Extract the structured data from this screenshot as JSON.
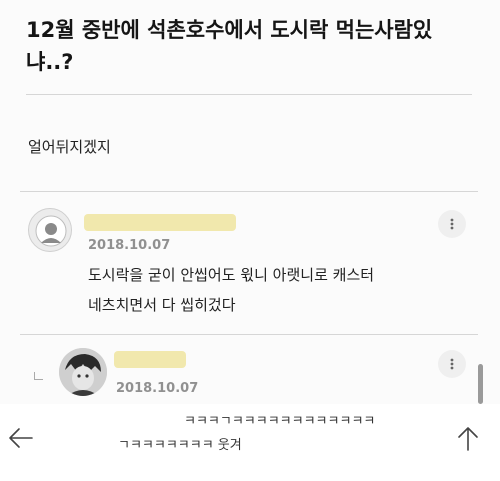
{
  "post": {
    "title": "12월 중반에 석촌호수에서 도시락 먹는사람있냐..?",
    "body": "얼어뒤지겠지"
  },
  "comments": [
    {
      "date": "2018.10.07",
      "text_line1": "도시락을 굳이 안씹어도 윇니 아랫니로 캐스터",
      "text_line2": "네츠치면서 다 씹히겄다",
      "more_icon": "more-vertical-icon"
    },
    {
      "date": "2018.10.07",
      "text_line1": "ㅋㅋㅋㄱㅋㅋㅋㅋㅋㅋㅋㅋㅋㅋㅋㅋ",
      "text_line2": "ㄱㅋㅋㅋㅋㅋㅋㅋ     웃겨",
      "is_reply": true
    }
  ],
  "nav": {
    "back_icon": "arrow-left-icon",
    "top_icon": "arrow-up-icon"
  },
  "colors": {
    "name_redaction": "#f1e8ad",
    "date": "#909090",
    "background": "#fbfbfb"
  }
}
